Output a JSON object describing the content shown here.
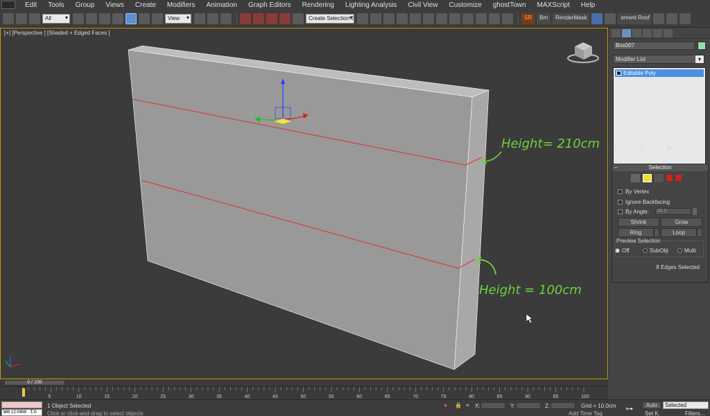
{
  "menu": {
    "items": [
      "Edit",
      "Tools",
      "Group",
      "Views",
      "Create",
      "Modifiers",
      "Animation",
      "Graph Editors",
      "Rendering",
      "Lighting Analysis",
      "Civil View",
      "Customize",
      "ghostTown",
      "MAXScript",
      "Help"
    ]
  },
  "toolbar": {
    "filter_value": "All",
    "refcoord_value": "View",
    "selection_set_value": "Create Selection S",
    "sr_label": "SR",
    "bm_label": "Bm",
    "rendermask_label": "RenderMask",
    "roof_label": "ement Roof S"
  },
  "viewport": {
    "label": "[+] [Perspective ] [Shaded + Edged Faces ]",
    "gizmo_x": "x",
    "gizmo_y": "y",
    "gizmo_z": "z",
    "annotation_top": "Height= 210cm",
    "annotation_bottom": "Height = 100cm"
  },
  "command_panel": {
    "object_name": "Box007",
    "object_color": "#8ee0b0",
    "modifier_list_label": "Modifier List",
    "stack_item": "Editable Poly",
    "selection_rollout": {
      "title": "Selection",
      "minus": "–",
      "by_vertex": "By Vertex",
      "ignore_backfacing": "Ignore Backfacing",
      "by_angle": "By Angle:",
      "angle_value": "45.0",
      "shrink": "Shrink",
      "grow": "Grow",
      "ring": "Ring",
      "loop": "Loop",
      "preview_label": "Preview Selection",
      "preview_off": "Off",
      "preview_subobj": "SubObj",
      "preview_multi": "Multi",
      "selected_info": "8 Edges Selected"
    }
  },
  "timeline": {
    "slider": "0 / 100",
    "ticks": [
      "5",
      "10",
      "15",
      "20",
      "25",
      "30",
      "35",
      "40",
      "45",
      "50",
      "55",
      "60",
      "65",
      "70",
      "75",
      "80",
      "85",
      "90",
      "95",
      "100"
    ]
  },
  "status": {
    "listener_text": "Welcome to",
    "selected_count": "1 Object Selected",
    "prompt": "Click or click-and-drag to select objects",
    "x_label": "X:",
    "y_label": "Y:",
    "z_label": "Z:",
    "grid": "Grid = 10.0cm",
    "add_time_tag": "Add Time Tag",
    "auto": "Auto",
    "set_key": "Set K.",
    "selected_value": "Selected",
    "filters": "Filters..."
  },
  "colors": {
    "viewport_bg": "#3b3b3b",
    "active_border": "#c8a000",
    "selected_edge": "#e03030",
    "annotation": "#6fd23a"
  }
}
